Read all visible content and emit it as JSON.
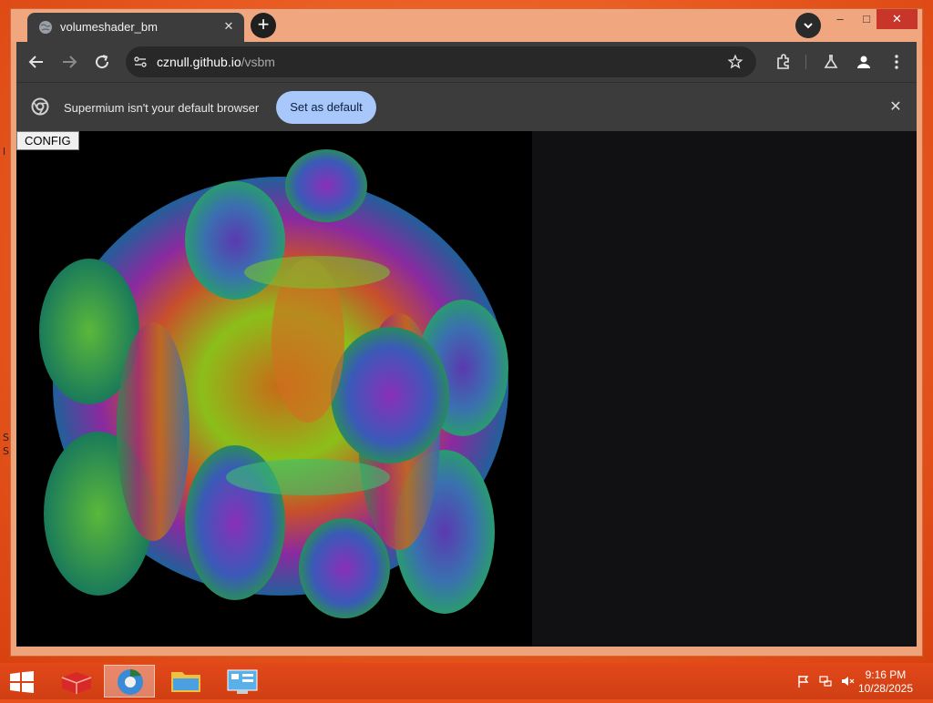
{
  "desktop": {
    "edge_letters": [
      "l",
      "S",
      "S"
    ]
  },
  "browser": {
    "tab": {
      "title": "volumeshader_bm",
      "close_icon": "close-icon"
    },
    "newtab_icon": "plus-icon",
    "tabsearch_icon": "chevron-down-icon",
    "window_controls": {
      "minimize": "–",
      "maximize": "□",
      "close": "✕"
    },
    "toolbar": {
      "url_host": "cznull.github.io",
      "url_path": "/vsbm"
    },
    "infobar": {
      "message": "Supermium isn't your default browser",
      "button": "Set as default",
      "close": "✕"
    }
  },
  "page": {
    "config_button": "CONFIG"
  },
  "taskbar": {
    "time": "9:16 PM",
    "date": "10/28/2025"
  },
  "colors": {
    "desktop_bg": "#ea5b22",
    "taskbar_bg": "#d8441a",
    "browser_chrome": "#3c3c3c",
    "accent_button": "#a8c7fa",
    "close_button": "#c8352a"
  }
}
